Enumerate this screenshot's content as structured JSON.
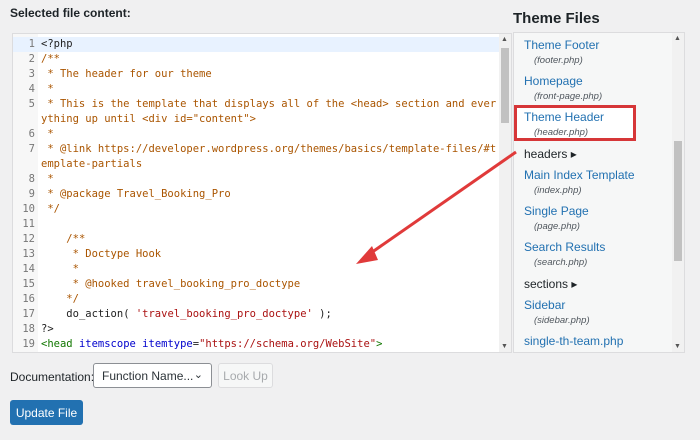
{
  "label": "Selected file content:",
  "code_lines": [
    {
      "n": "1",
      "html": "&lt;?php"
    },
    {
      "n": "2",
      "html": "<span class='c'>/**</span>"
    },
    {
      "n": "3",
      "html": "<span class='c'> * The header for our theme</span>"
    },
    {
      "n": "4",
      "html": "<span class='c'> *</span>"
    },
    {
      "n": "5",
      "html": "<span class='c'> * This is the template that displays all of the &lt;head&gt; section and everything up until &lt;div id=\"content\"&gt;</span>"
    },
    {
      "n": "6",
      "html": "<span class='c'> *</span>"
    },
    {
      "n": "7",
      "html": "<span class='c'> * @link https://developer.wordpress.org/themes/basics/template-files/#template-partials</span>"
    },
    {
      "n": "8",
      "html": "<span class='c'> *</span>"
    },
    {
      "n": "9",
      "html": "<span class='c'> * @package Travel_Booking_Pro</span>"
    },
    {
      "n": "10",
      "html": "<span class='c'> */</span>"
    },
    {
      "n": "11",
      "html": ""
    },
    {
      "n": "12",
      "html": "<span class='c'>    /**</span>"
    },
    {
      "n": "13",
      "html": "<span class='c'>     * Doctype Hook</span>"
    },
    {
      "n": "14",
      "html": "<span class='c'>     *</span>"
    },
    {
      "n": "15",
      "html": "<span class='c'>     * @hooked travel_booking_pro_doctype</span>"
    },
    {
      "n": "16",
      "html": "<span class='c'>    */</span>"
    },
    {
      "n": "17",
      "html": "    do_action( <span class='s'>'travel_booking_pro_doctype'</span> );"
    },
    {
      "n": "18",
      "html": "?&gt;"
    },
    {
      "n": "19",
      "html": "<span class='t'>&lt;head</span> <span class='a'>itemscope</span> <span class='a'>itemtype</span>=<span class='s'>\"https://schema.org/WebSite\"</span><span class='t'>&gt;</span>"
    }
  ],
  "theme_files": {
    "title": "Theme Files",
    "items": [
      {
        "type": "file",
        "name": "Theme Footer",
        "file": "(footer.php)"
      },
      {
        "type": "file",
        "name": "Homepage",
        "file": "(front-page.php)"
      },
      {
        "type": "file",
        "name": "Theme Header",
        "file": "(header.php)",
        "selected": true
      },
      {
        "type": "dir",
        "name": "headers ▸"
      },
      {
        "type": "file",
        "name": "Main Index Template",
        "file": "(index.php)"
      },
      {
        "type": "file",
        "name": "Single Page",
        "file": "(page.php)"
      },
      {
        "type": "file",
        "name": "Search Results",
        "file": "(search.php)"
      },
      {
        "type": "dir",
        "name": "sections ▸"
      },
      {
        "type": "file",
        "name": "Sidebar",
        "file": "(sidebar.php)"
      },
      {
        "type": "file",
        "name": "single-th-team.php",
        "file": ""
      }
    ]
  },
  "documentation": {
    "label": "Documentation:",
    "select_value": "Function Name...",
    "lookup": "Look Up"
  },
  "update_button": "Update File",
  "colors": {
    "accent": "#2271b1",
    "highlight": "#d63638"
  }
}
